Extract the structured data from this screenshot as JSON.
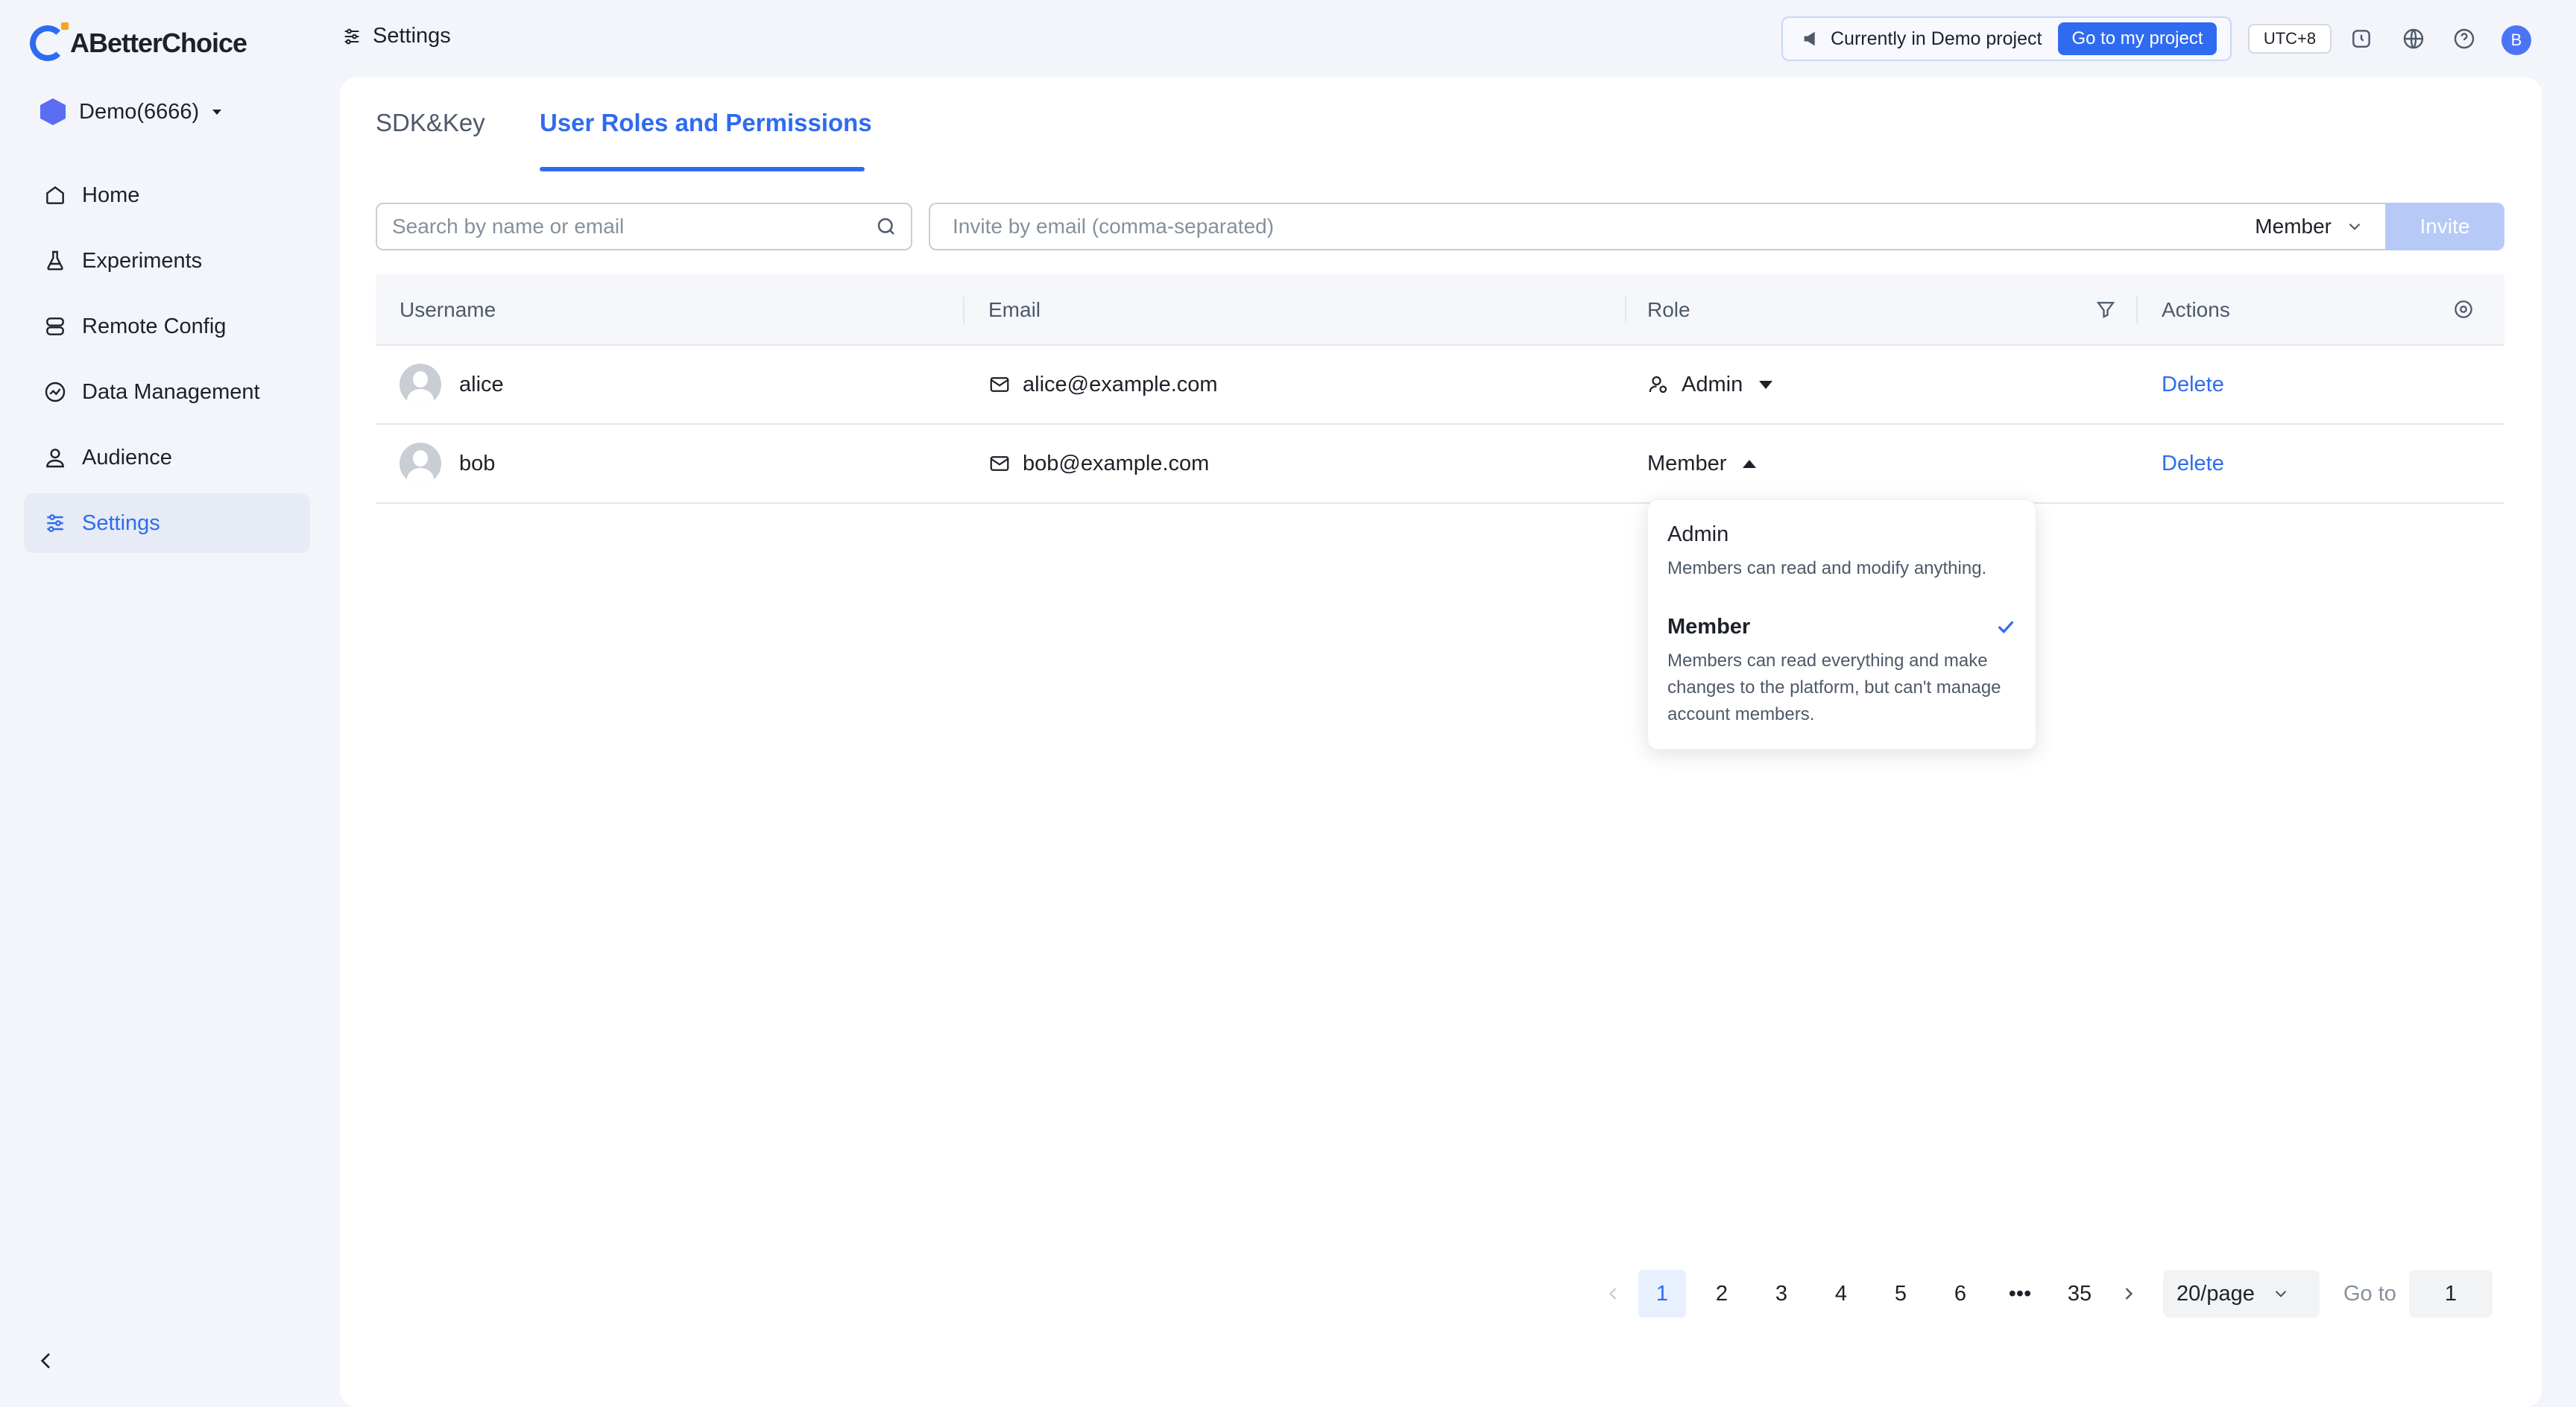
{
  "brand": {
    "name": "ABetterChoice",
    "accent": "#2f6bf0"
  },
  "project": {
    "name": "Demo(6666)"
  },
  "sidebar": {
    "items": [
      {
        "label": "Home",
        "icon": "home-icon"
      },
      {
        "label": "Experiments",
        "icon": "flask-icon"
      },
      {
        "label": "Remote Config",
        "icon": "server-icon"
      },
      {
        "label": "Data Management",
        "icon": "chart-icon"
      },
      {
        "label": "Audience",
        "icon": "user-icon"
      },
      {
        "label": "Settings",
        "icon": "sliders-icon",
        "active": true
      }
    ]
  },
  "header": {
    "title": "Settings",
    "demo_notice": "Currently in Demo project",
    "demo_button": "Go to my project",
    "timezone": "UTC+8",
    "user_initial": "B"
  },
  "tabs": [
    {
      "label": "SDK&Key",
      "active": false
    },
    {
      "label": "User Roles and Permissions",
      "active": true
    }
  ],
  "toolbar": {
    "search_placeholder": "Search by name or email",
    "invite_placeholder": "Invite by email (comma-separated)",
    "invite_role": "Member",
    "invite_button": "Invite"
  },
  "table": {
    "columns": [
      "Username",
      "Email",
      "Role",
      "Actions"
    ],
    "rows": [
      {
        "username": "alice",
        "email": "alice@example.com",
        "role": "Admin",
        "action": "Delete"
      },
      {
        "username": "bob",
        "email": "bob@example.com",
        "role": "Member",
        "action": "Delete"
      }
    ]
  },
  "role_dropdown": {
    "options": [
      {
        "title": "Admin",
        "description": "Members can read and modify anything.",
        "selected": false
      },
      {
        "title": "Member",
        "description": "Members can read everything and make changes to the platform, but can't manage account members.",
        "selected": true
      }
    ]
  },
  "pagination": {
    "pages": [
      "1",
      "2",
      "3",
      "4",
      "5",
      "6",
      "•••",
      "35"
    ],
    "current": "1",
    "page_size": "20/page",
    "goto_label": "Go to",
    "goto_value": "1"
  }
}
